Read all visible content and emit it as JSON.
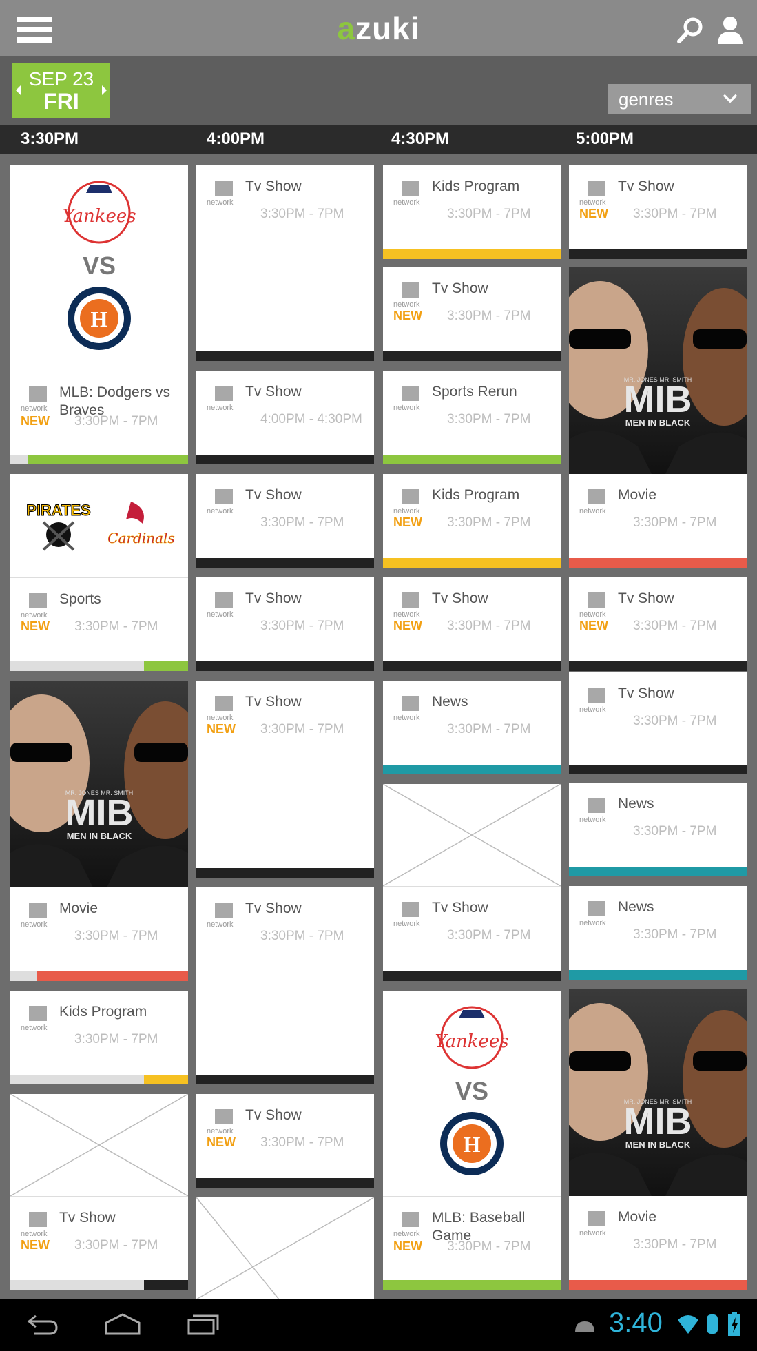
{
  "app": {
    "logo_accent": "a",
    "logo_rest": "zuki",
    "accent_color": "#8dc63f"
  },
  "date": {
    "month_day": "SEP 23",
    "weekday": "FRI"
  },
  "genres": {
    "label": "genres"
  },
  "times": [
    "3:30PM",
    "4:00PM",
    "4:30PM",
    "5:00PM"
  ],
  "network_label": "network",
  "new_label": "NEW",
  "colors": {
    "green": "#8dc63f",
    "yellow": "#f6c122",
    "red": "#e85b4a",
    "teal": "#1f9aa5",
    "black": "#222222",
    "lightgray": "#dedede"
  },
  "cards": [
    {
      "title": "MLB: Dodgers vs Braves",
      "new": true,
      "time": "3:30PM - 7PM",
      "color": "green",
      "progress": 0.1
    },
    {
      "title": "Sports",
      "new": true,
      "time": "3:30PM - 7PM",
      "color": "green",
      "progress": 0.75
    },
    {
      "title": "Movie",
      "new": false,
      "time": "3:30PM - 7PM",
      "color": "red",
      "progress": 0.15
    },
    {
      "title": "Kids Program",
      "new": false,
      "time": "3:30PM - 7PM",
      "color": "yellow",
      "progress": 0.75
    },
    {
      "title": "Tv Show",
      "new": true,
      "time": "3:30PM - 7PM",
      "color": "black",
      "progress": 0.75
    },
    {
      "title": "Tv Show",
      "new": false,
      "time": "3:30PM - 7PM",
      "color": "black",
      "progress": 0
    },
    {
      "title": "Tv Show",
      "new": false,
      "time": "4:00PM - 4:30PM",
      "color": "black",
      "progress": 0
    },
    {
      "title": "Tv Show",
      "new": false,
      "time": "3:30PM - 7PM",
      "color": "black",
      "progress": 0
    },
    {
      "title": "Tv Show",
      "new": false,
      "time": "3:30PM - 7PM",
      "color": "black",
      "progress": 0
    },
    {
      "title": "Tv Show",
      "new": true,
      "time": "3:30PM - 7PM",
      "color": "black",
      "progress": 0
    },
    {
      "title": "Tv Show",
      "new": false,
      "time": "3:30PM - 7PM",
      "color": "black",
      "progress": 0
    },
    {
      "title": "Tv Show",
      "new": true,
      "time": "3:30PM - 7PM",
      "color": "black",
      "progress": 0
    },
    {
      "title": "Kids Program",
      "new": false,
      "time": "3:30PM - 7PM",
      "color": "yellow",
      "progress": 0
    },
    {
      "title": "Tv Show",
      "new": true,
      "time": "3:30PM - 7PM",
      "color": "black",
      "progress": 0
    },
    {
      "title": "Sports Rerun",
      "new": false,
      "time": "3:30PM - 7PM",
      "color": "green",
      "progress": 0
    },
    {
      "title": "Kids Program",
      "new": true,
      "time": "3:30PM - 7PM",
      "color": "yellow",
      "progress": 0
    },
    {
      "title": "Tv Show",
      "new": true,
      "time": "3:30PM - 7PM",
      "color": "black",
      "progress": 0
    },
    {
      "title": "News",
      "new": false,
      "time": "3:30PM - 7PM",
      "color": "teal",
      "progress": 0
    },
    {
      "title": "Tv Show",
      "new": false,
      "time": "3:30PM - 7PM",
      "color": "black",
      "progress": 0
    },
    {
      "title": "MLB: Baseball Game",
      "new": true,
      "time": "3:30PM - 7PM",
      "color": "green",
      "progress": 0
    },
    {
      "title": "Tv Show",
      "new": true,
      "time": "3:30PM - 7PM",
      "color": "black",
      "progress": 0
    },
    {
      "title": "Movie",
      "new": false,
      "time": "3:30PM - 7PM",
      "color": "red",
      "progress": 0
    },
    {
      "title": "Tv Show",
      "new": true,
      "time": "3:30PM - 7PM",
      "color": "black",
      "progress": 0
    },
    {
      "title": "Tv Show",
      "new": false,
      "time": "3:30PM - 7PM",
      "color": "black",
      "progress": 0
    },
    {
      "title": "News",
      "new": false,
      "time": "3:30PM - 7PM",
      "color": "teal",
      "progress": 0
    },
    {
      "title": "News",
      "new": false,
      "time": "3:30PM - 7PM",
      "color": "teal",
      "progress": 0
    },
    {
      "title": "Movie",
      "new": false,
      "time": "3:30PM - 7PM",
      "color": "red",
      "progress": 0
    }
  ],
  "images": {
    "vs": "VS",
    "poster_names": "MR. JONES  MR. SMITH",
    "poster_title": "MIB",
    "poster_subtitle": "MEN IN BLACK",
    "pirates": "PIRATES",
    "cardinals": "Cardinals",
    "yankees": "Yankees",
    "astros_top": "HOUSTON",
    "astros_bottom": "ASTROS",
    "astros_letter": "H"
  },
  "status": {
    "clock": "3:40"
  }
}
